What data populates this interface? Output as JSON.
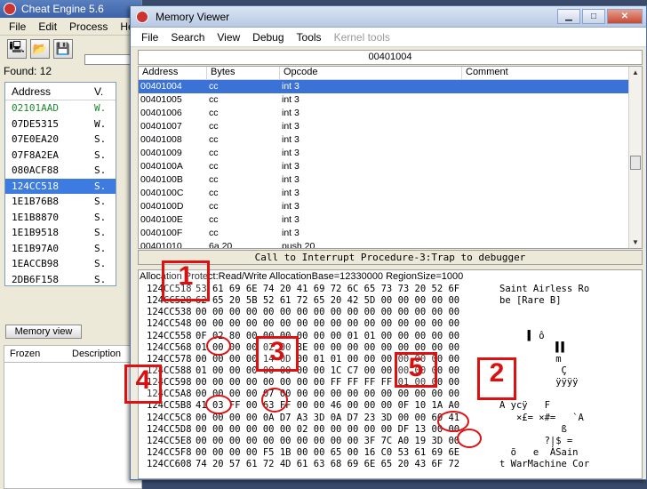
{
  "main": {
    "title": "Cheat Engine 5.6",
    "menu": [
      "File",
      "Edit",
      "Process",
      "He"
    ],
    "found": "Found: 12",
    "columns": [
      "Address",
      "V."
    ],
    "rows": [
      {
        "address": "02101AAD",
        "v": "W."
      },
      {
        "address": "07DE5315",
        "v": "W."
      },
      {
        "address": "07E0EA20",
        "v": "S."
      },
      {
        "address": "07F8A2EA",
        "v": "S."
      },
      {
        "address": "080ACF88",
        "v": "S."
      },
      {
        "address": "124CC518",
        "v": "S."
      },
      {
        "address": "1E1B76B8",
        "v": "S."
      },
      {
        "address": "1E1B8870",
        "v": "S."
      },
      {
        "address": "1E1B9518",
        "v": "S."
      },
      {
        "address": "1E1B97A0",
        "v": "S."
      },
      {
        "address": "1EACCB98",
        "v": "S."
      },
      {
        "address": "2DB6F158",
        "v": "S."
      }
    ],
    "memory_view_button": "Memory view",
    "frozen_columns": [
      "Frozen",
      "Description"
    ]
  },
  "viewer": {
    "title": "Memory Viewer",
    "menu": [
      "File",
      "Search",
      "View",
      "Debug",
      "Tools"
    ],
    "menu_disabled": "Kernel tools",
    "current_address": "00401004",
    "columns": [
      "Address",
      "Bytes",
      "Opcode",
      "Comment"
    ],
    "disasm": [
      {
        "address": "00401004",
        "bytes": "cc",
        "opcode": "int 3"
      },
      {
        "address": "00401005",
        "bytes": "cc",
        "opcode": "int 3"
      },
      {
        "address": "00401006",
        "bytes": "cc",
        "opcode": "int 3"
      },
      {
        "address": "00401007",
        "bytes": "cc",
        "opcode": "int 3"
      },
      {
        "address": "00401008",
        "bytes": "cc",
        "opcode": "int 3"
      },
      {
        "address": "00401009",
        "bytes": "cc",
        "opcode": "int 3"
      },
      {
        "address": "0040100A",
        "bytes": "cc",
        "opcode": "int 3"
      },
      {
        "address": "0040100B",
        "bytes": "cc",
        "opcode": "int 3"
      },
      {
        "address": "0040100C",
        "bytes": "cc",
        "opcode": "int 3"
      },
      {
        "address": "0040100D",
        "bytes": "cc",
        "opcode": "int 3"
      },
      {
        "address": "0040100E",
        "bytes": "cc",
        "opcode": "int 3"
      },
      {
        "address": "0040100F",
        "bytes": "cc",
        "opcode": "int 3"
      },
      {
        "address": "00401010",
        "bytes": "6a 20",
        "opcode": "push 20"
      }
    ],
    "info_line": "Call to Interrupt Procedure-3:Trap to debugger",
    "hex_header": "Allocation  Protect:Read/Write  AllocationBase=12330000 RegionSize=1000",
    "hex_rows": [
      {
        "addr": "124CC518",
        "bytes": "53 61 69 6E 74 20 41 69 72 6C 65 73 73 20 52 6F",
        "ascii": "Saint Airless Ro"
      },
      {
        "addr": "124CC528",
        "bytes": "62 65 20 5B 52 61 72 65 20 42 5D 00 00 00 00 00",
        "ascii": "be [Rare B]"
      },
      {
        "addr": "124CC538",
        "bytes": "00 00 00 00 00 00 00 00 00 00 00 00 00 00 00 00",
        "ascii": ""
      },
      {
        "addr": "124CC548",
        "bytes": "00 00 00 00 00 00 00 00 00 00 00 00 00 00 00 00",
        "ascii": ""
      },
      {
        "addr": "124CC558",
        "bytes": "0F 02 80 00 00 00 00 00 00 01 01 00 00 00 00 00",
        "ascii": "     ▌ ô"
      },
      {
        "addr": "124CC568",
        "bytes": "01 00 00 00 02 00 8E 00 00 00 00 00 00 00 00 00",
        "ascii": "          ▌▌"
      },
      {
        "addr": "124CC578",
        "bytes": "00 00 00 00 14 0D 00 01 01 00 00 00 00 00 00 00",
        "ascii": "          m"
      },
      {
        "addr": "124CC588",
        "bytes": "01 00 00 00 00 00 00 00 1C C7 00 00 00 00 00 00",
        "ascii": "           Ç"
      },
      {
        "addr": "124CC598",
        "bytes": "00 00 00 00 00 00 00 00 FF FF FF FF 01 00 00 00",
        "ascii": "          ÿÿÿÿ"
      },
      {
        "addr": "124CC5A8",
        "bytes": "00 00 00 00 07 00 00 00 00 00 00 00 00 00 00 00",
        "ascii": ""
      },
      {
        "addr": "124CC5B8",
        "bytes": "41 03 FF 00 63 FF 00 00 46 00 00 00 0F 10 1A A0",
        "ascii": "A ycÿ   F"
      },
      {
        "addr": "124CC5C8",
        "bytes": "00 00 00 00 0A D7 A3 3D 0A D7 23 3D 00 00 60 41",
        "ascii": "   ×£= ×#=   `A"
      },
      {
        "addr": "124CC5D8",
        "bytes": "00 00 00 00 00 00 02 00 00 00 00 00 DF 13 00 00",
        "ascii": "           ß"
      },
      {
        "addr": "124CC5E8",
        "bytes": "00 00 00 00 00 00 00 00 00 00 3F 7C A0 19 3D 00",
        "ascii": "        ?|$ ="
      },
      {
        "addr": "124CC5F8",
        "bytes": "00 00 00 00 F5 1B 00 00 65 00 16 C0 53 61 69 6E",
        "ascii": "  õ   e  ÀSain"
      },
      {
        "addr": "124CC608",
        "bytes": "74 20 57 61 72 4D 61 63 68 69 6E 65 20 43 6F 72",
        "ascii": "t WarMachine Cor"
      }
    ]
  },
  "annotations": [
    "1",
    "2",
    "3",
    "4",
    "5"
  ]
}
